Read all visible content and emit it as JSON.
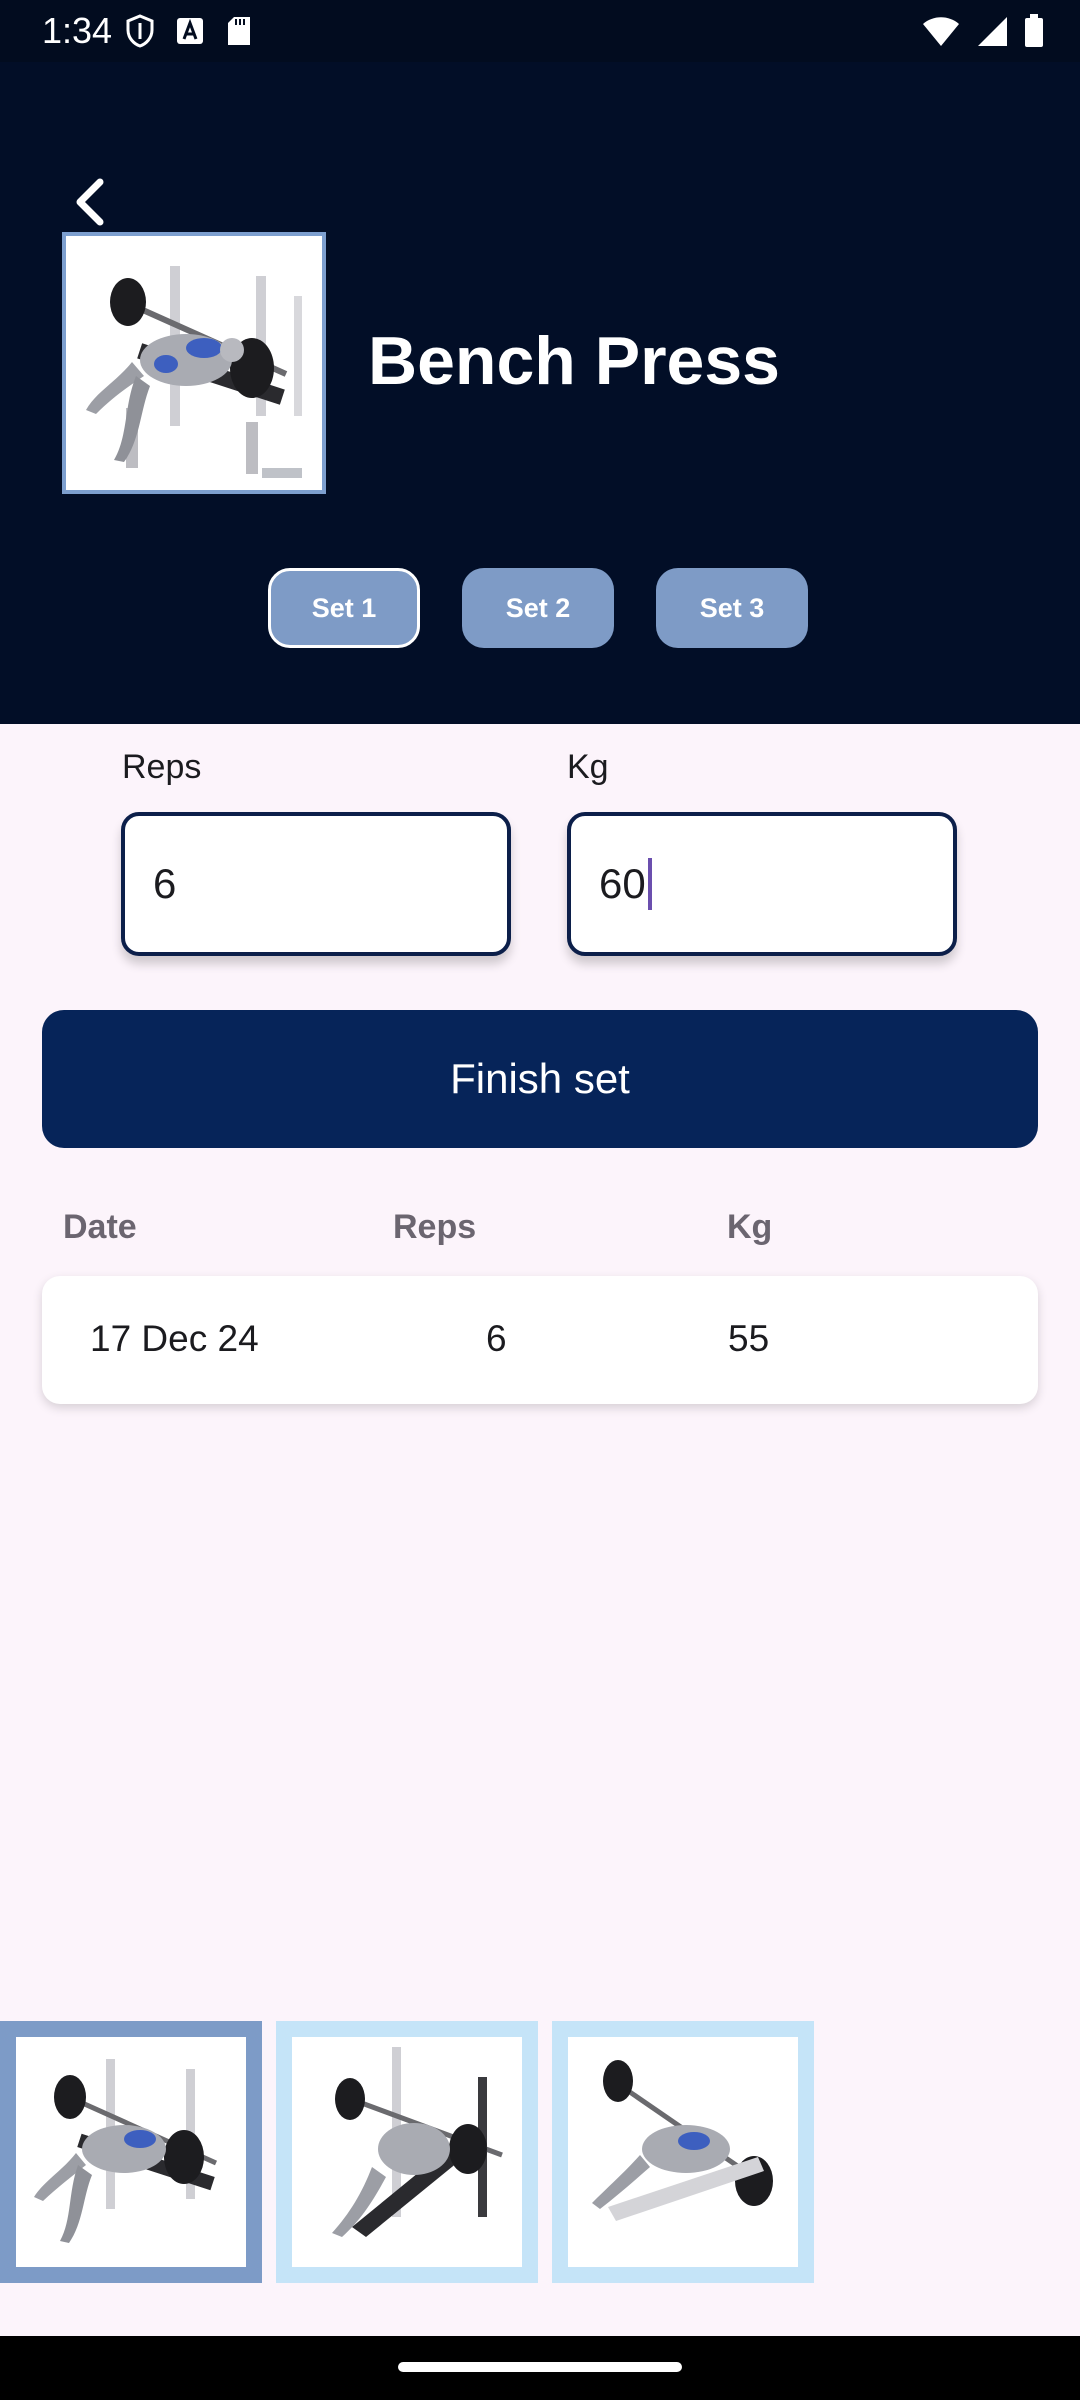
{
  "status": {
    "time": "1:34"
  },
  "exercise": {
    "title": "Bench Press",
    "image_icon": "bench-press-illustration"
  },
  "sets": [
    {
      "label": "Set 1"
    },
    {
      "label": "Set 2"
    },
    {
      "label": "Set 3"
    }
  ],
  "form": {
    "reps_label": "Reps",
    "reps_value": "6",
    "kg_label": "Kg",
    "kg_value": "60"
  },
  "finish_button": "Finish set",
  "history": {
    "headers": {
      "date": "Date",
      "reps": "Reps",
      "kg": "Kg"
    },
    "rows": [
      {
        "date": "17 Dec 24",
        "reps": "6",
        "kg": "55"
      }
    ]
  },
  "thumbnails": [
    {
      "icon": "flat-bench-press-illustration"
    },
    {
      "icon": "incline-bench-press-illustration"
    },
    {
      "icon": "decline-bench-press-illustration"
    }
  ],
  "colors": {
    "header_bg": "#020e27",
    "accent": "#062459",
    "set_button": "#7e9bc6",
    "page_bg": "#fcf4fb"
  }
}
